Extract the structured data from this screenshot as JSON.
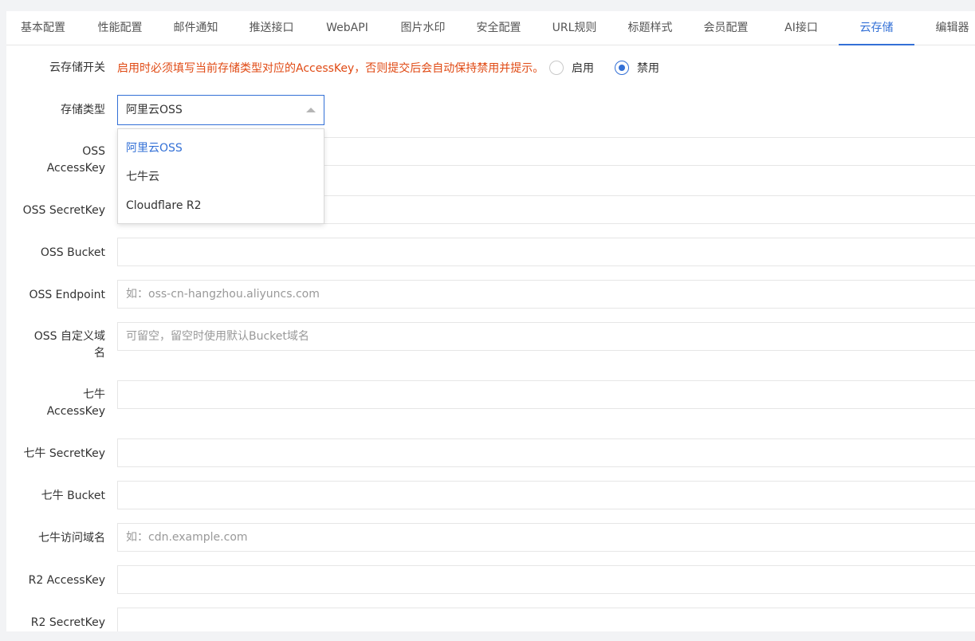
{
  "tabs": [
    {
      "label": "基本配置",
      "active": false
    },
    {
      "label": "性能配置",
      "active": false
    },
    {
      "label": "邮件通知",
      "active": false
    },
    {
      "label": "推送接口",
      "active": false
    },
    {
      "label": "WebAPI",
      "active": false
    },
    {
      "label": "图片水印",
      "active": false
    },
    {
      "label": "安全配置",
      "active": false
    },
    {
      "label": "URL规则",
      "active": false
    },
    {
      "label": "标题样式",
      "active": false
    },
    {
      "label": "会员配置",
      "active": false
    },
    {
      "label": "AI接口",
      "active": false
    },
    {
      "label": "云存储",
      "active": true
    },
    {
      "label": "编辑器",
      "active": false
    }
  ],
  "colors": {
    "accent": "#3370d6",
    "warning": "#e04a14"
  },
  "storage_switch": {
    "label": "云存储开关",
    "hint": "启用时必须填写当前存储类型对应的AccessKey，否则提交后会自动保持禁用并提示。",
    "options": [
      {
        "label": "启用",
        "checked": false
      },
      {
        "label": "禁用",
        "checked": true
      }
    ]
  },
  "storage_type": {
    "label": "存储类型",
    "selected": "阿里云OSS",
    "open": true,
    "options": [
      "阿里云OSS",
      "七牛云",
      "Cloudflare R2"
    ]
  },
  "fields": {
    "oss_accesskey": {
      "label_line1": "OSS",
      "label_line2": "AccessKey",
      "value": "",
      "placeholder": ""
    },
    "oss_secretkey": {
      "label": "OSS SecretKey",
      "value": "",
      "placeholder": ""
    },
    "oss_bucket": {
      "label": "OSS Bucket",
      "value": "",
      "placeholder": ""
    },
    "oss_endpoint": {
      "label": "OSS Endpoint",
      "value": "",
      "placeholder": "如：oss-cn-hangzhou.aliyuncs.com"
    },
    "oss_domain": {
      "label_line1": "OSS 自定义域",
      "label_line2": "名",
      "value": "",
      "placeholder": "可留空，留空时使用默认Bucket域名"
    },
    "qiniu_accesskey": {
      "label_line1": "七牛",
      "label_line2": "AccessKey",
      "value": "",
      "placeholder": ""
    },
    "qiniu_secretkey": {
      "label": "七牛 SecretKey",
      "value": "",
      "placeholder": ""
    },
    "qiniu_bucket": {
      "label": "七牛 Bucket",
      "value": "",
      "placeholder": ""
    },
    "qiniu_domain": {
      "label": "七牛访问域名",
      "value": "",
      "placeholder": "如：cdn.example.com"
    },
    "r2_accesskey": {
      "label": "R2 AccessKey",
      "value": "",
      "placeholder": ""
    },
    "r2_secretkey": {
      "label": "R2 SecretKey",
      "value": "",
      "placeholder": ""
    }
  }
}
